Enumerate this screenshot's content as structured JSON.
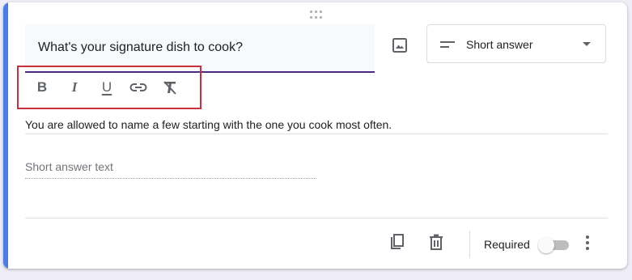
{
  "question": {
    "title": "What's your signature dish to cook?",
    "description": "You are allowed to name a few starting with the one you cook most often.",
    "type_label": "Short answer",
    "answer_placeholder": "Short answer text",
    "required_label": "Required",
    "required": false
  },
  "icons": {
    "drag": "drag-handle-icon",
    "image": "image-icon",
    "type": "short-answer-lines-icon",
    "dropdown": "chevron-down-icon",
    "bold": "bold-icon",
    "italic": "italic-icon",
    "underline": "underline-icon",
    "link": "link-icon",
    "clear_format": "clear-format-icon",
    "duplicate": "duplicate-icon",
    "delete": "trash-icon",
    "more": "more-vert-icon"
  },
  "format_toolbar": {
    "bold_label": "B",
    "italic_label": "I",
    "underline_label": "U"
  },
  "colors": {
    "accent": "#4a7de6",
    "question_underline": "#4b2a86",
    "highlight_box": "#c8303c",
    "background": "#efeef8"
  }
}
